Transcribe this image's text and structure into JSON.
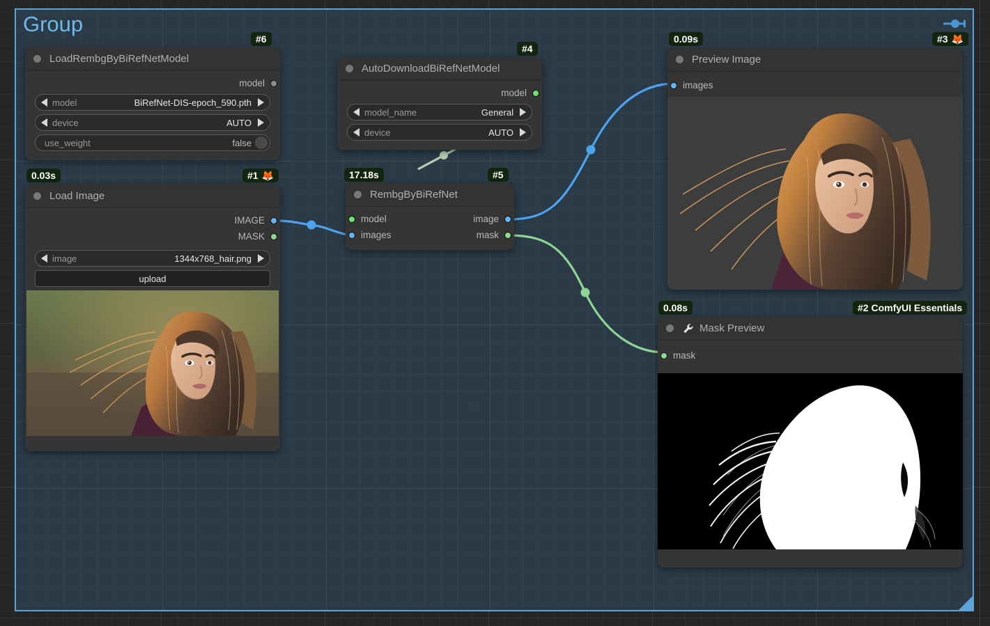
{
  "app": {
    "canvas_bg": "#262626",
    "group_bg": "#2b3a47",
    "group_border": "#5da3d6"
  },
  "group": {
    "title": "Group",
    "link_icon": "link-node-icon",
    "resize_handle": "resize-handle-icon"
  },
  "nodes": [
    {
      "id": "load-rembg-model",
      "title": "LoadRembgByBiRefNetModel",
      "badge": "#6",
      "badge_emoji": "",
      "time": null,
      "outputs": [
        {
          "label": "model",
          "color": "#8c8c8c",
          "type": "model-grey"
        }
      ],
      "inputs": [],
      "widgets": [
        {
          "name": "model",
          "value": "BiRefNet-DIS-epoch_590.pth",
          "kind": "combo"
        },
        {
          "name": "device",
          "value": "AUTO",
          "kind": "combo"
        },
        {
          "name": "use_weight",
          "value": "false",
          "kind": "toggle"
        }
      ]
    },
    {
      "id": "auto-download-model",
      "title": "AutoDownloadBiRefNetModel",
      "badge": "#4",
      "badge_emoji": "",
      "time": null,
      "outputs": [
        {
          "label": "model",
          "color": "#6ee36e",
          "type": "model"
        }
      ],
      "inputs": [],
      "widgets": [
        {
          "name": "model_name",
          "value": "General",
          "kind": "combo"
        },
        {
          "name": "device",
          "value": "AUTO",
          "kind": "combo"
        }
      ]
    },
    {
      "id": "load-image",
      "title": "Load Image",
      "badge": "#1",
      "badge_emoji": "🦊",
      "time": "0.03s",
      "outputs": [
        {
          "label": "IMAGE",
          "color": "#64b5f6",
          "type": "image"
        },
        {
          "label": "MASK",
          "color": "#8fd694",
          "type": "mask"
        }
      ],
      "inputs": [],
      "widgets": [
        {
          "name": "image",
          "value": "1344x768_hair.png",
          "kind": "combo"
        },
        {
          "name": "upload",
          "value": "upload",
          "kind": "button"
        }
      ]
    },
    {
      "id": "rembg-by-birefnet",
      "title": "RembgByBiRefNet",
      "badge": "#5",
      "badge_emoji": "",
      "time": "17.18s",
      "inputs": [
        {
          "label": "model",
          "color": "#6ee36e",
          "type": "model"
        },
        {
          "label": "images",
          "color": "#64b5f6",
          "type": "image"
        }
      ],
      "outputs": [
        {
          "label": "image",
          "color": "#64b5f6",
          "type": "image"
        },
        {
          "label": "mask",
          "color": "#8fd694",
          "type": "mask"
        }
      ],
      "widgets": []
    },
    {
      "id": "preview-image",
      "title": "Preview Image",
      "badge": "#3",
      "badge_emoji": "🦊",
      "time": "0.09s",
      "inputs": [
        {
          "label": "images",
          "color": "#64b5f6",
          "type": "image"
        }
      ],
      "outputs": [],
      "widgets": []
    },
    {
      "id": "mask-preview",
      "title": "Mask Preview",
      "badge": "#2 ComfyUI Essentials",
      "badge_emoji": "",
      "time": "0.08s",
      "header_icon": "wrench-icon",
      "inputs": [
        {
          "label": "mask",
          "color": "#8fd694",
          "type": "mask"
        }
      ],
      "outputs": [],
      "widgets": []
    }
  ],
  "links": [
    {
      "from": "load-image.IMAGE",
      "to": "rembg-by-birefnet.images",
      "color": "#4ea3ef"
    },
    {
      "from": "auto-download-model.model",
      "to": "rembg-by-birefnet.model",
      "color": "#b8ccb0"
    },
    {
      "from": "rembg-by-birefnet.image",
      "to": "preview-image.images",
      "color": "#4ea3ef"
    },
    {
      "from": "rembg-by-birefnet.mask",
      "to": "mask-preview.mask",
      "color": "#8fd694"
    }
  ]
}
